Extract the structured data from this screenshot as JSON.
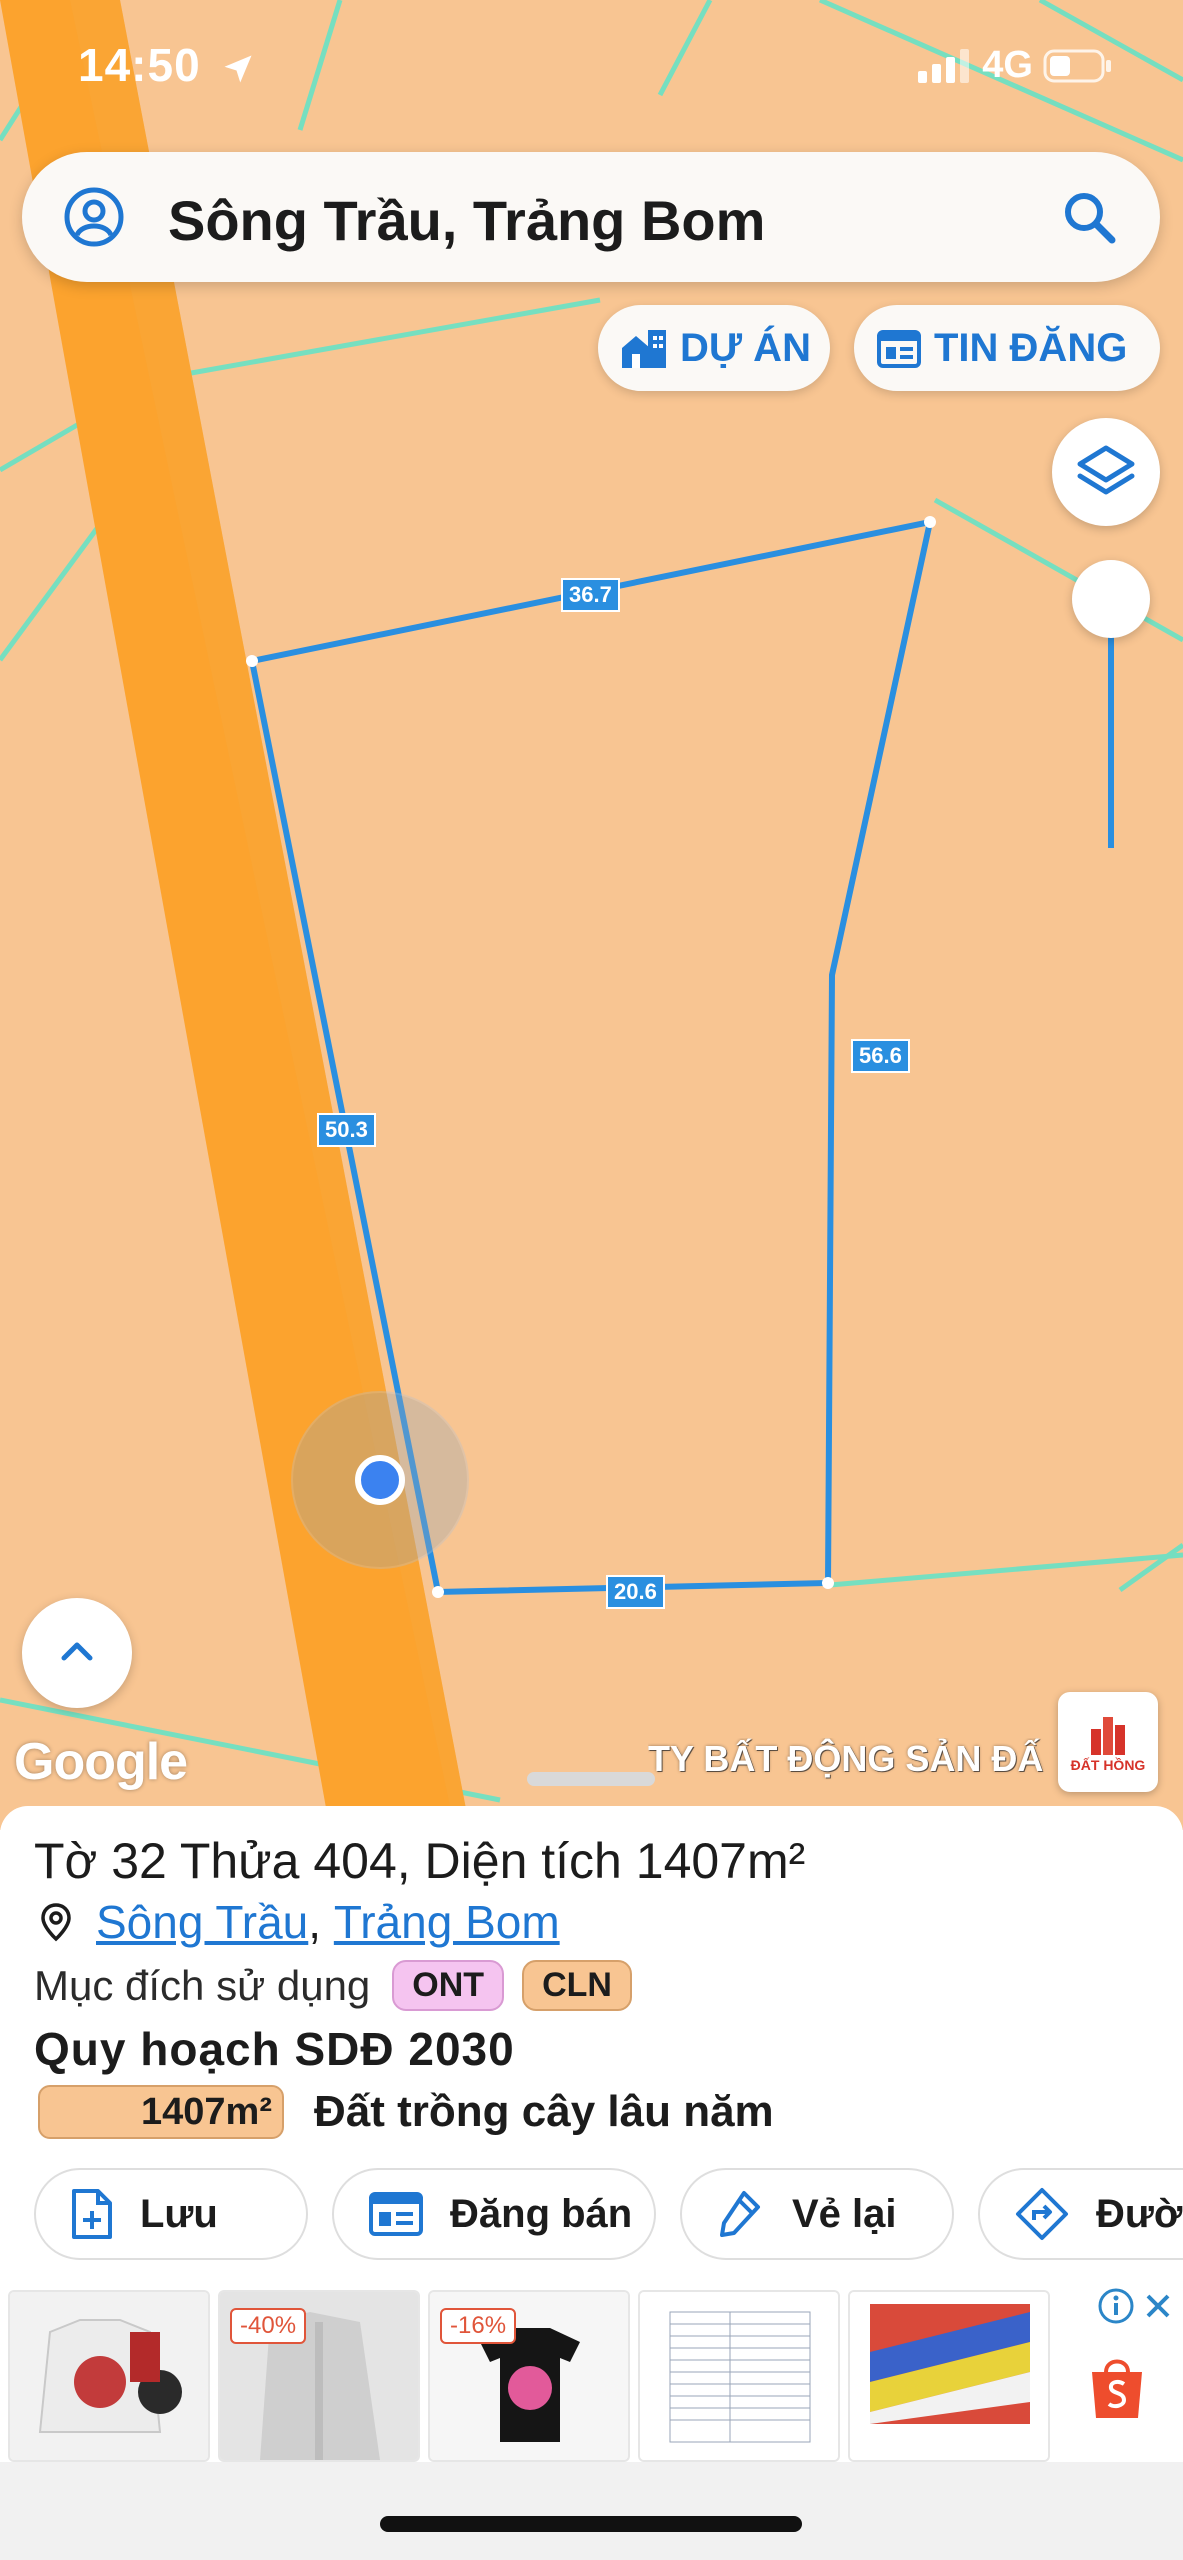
{
  "status_bar": {
    "time": "14:50",
    "network": "4G"
  },
  "search": {
    "query": "Sông Trầu, Trảng Bom"
  },
  "top_buttons": {
    "du_an": "DỰ ÁN",
    "tin_dang": "TIN ĐĂNG"
  },
  "map": {
    "edge_labels": [
      "36.7",
      "50.3",
      "56.6",
      "20.6"
    ],
    "attribution": "Google",
    "watermark": "TY BẤT ĐỘNG SẢN ĐẤ",
    "logo_text": "ĐẤT HỒNG"
  },
  "sheet": {
    "title": "Tờ 32 Thửa 404, Diện tích 1407m²",
    "location_commune": "Sông Trầu",
    "location_separator": ", ",
    "location_district": "Trảng Bom",
    "purpose_label": "Mục đích sử dụng",
    "purpose_badges": [
      "ONT",
      "CLN"
    ],
    "plan_title": "Quy hoạch SDĐ 2030",
    "plan_area": "1407m²",
    "plan_type": "Đất trồng cây lâu năm"
  },
  "actions": {
    "save": "Lưu",
    "post": "Đăng bán",
    "redraw": "Vẻ lại",
    "route": "Đườn"
  },
  "ads": {
    "discounts": [
      "-40%",
      "-16%"
    ]
  },
  "colors": {
    "accent": "#1f77d2",
    "map_land": "#f8c592",
    "road": "#fca32e",
    "parcel_line": "#2a8fe0",
    "boundary": "#6fe0c3"
  }
}
